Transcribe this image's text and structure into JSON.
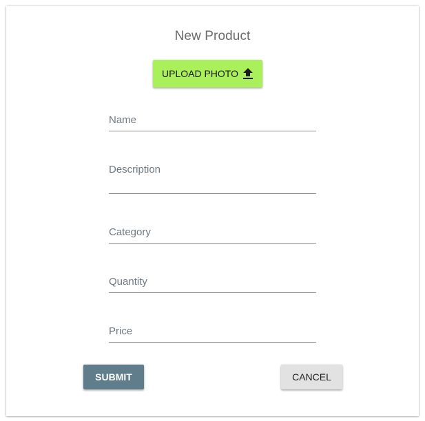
{
  "form": {
    "title": "New Product",
    "upload_label": "UPLOAD PHOTO",
    "upload_icon": "upload-icon",
    "fields": {
      "name": {
        "label": "Name",
        "value": ""
      },
      "description": {
        "label": "Description",
        "value": ""
      },
      "category": {
        "label": "Category",
        "value": ""
      },
      "quantity": {
        "label": "Quantity",
        "value": ""
      },
      "price": {
        "label": "Price",
        "value": ""
      }
    },
    "submit_label": "SUBMIT",
    "cancel_label": "CANCEL"
  },
  "colors": {
    "upload_button": "#aaf05a",
    "submit_button": "#607d8b",
    "cancel_button": "#e2e2e2",
    "label_text": "#6f7882",
    "title_text": "#6b6b6b"
  }
}
